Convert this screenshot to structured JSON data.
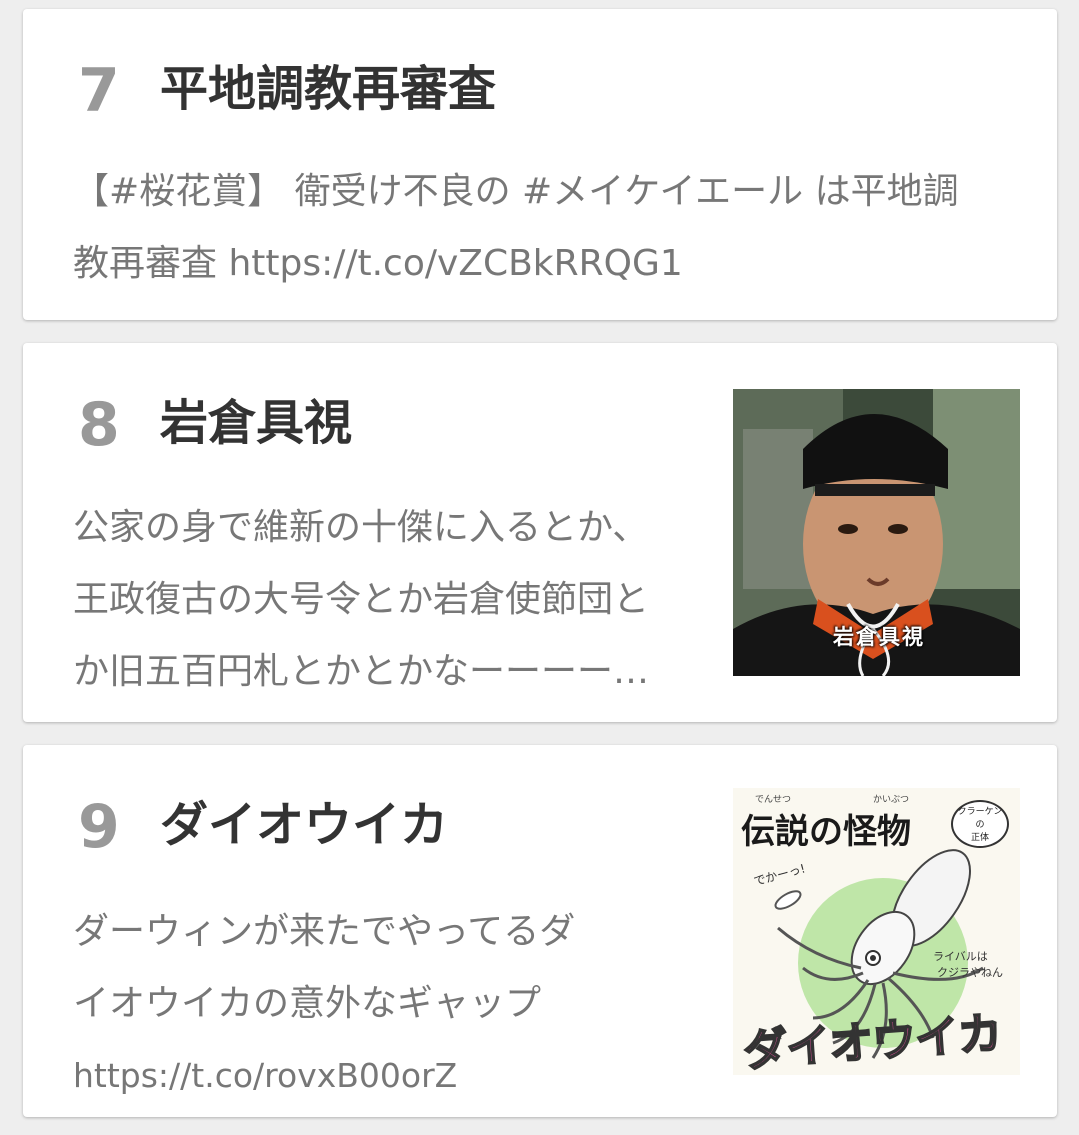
{
  "items": [
    {
      "rank": "7",
      "title": "平地調教再審査",
      "lines": [
        "【#桜花賞】 衛受け不良の #メイケイエール は平地調",
        "教再審査 https://t.co/vZCBkRRQG1"
      ]
    },
    {
      "rank": "8",
      "title": "岩倉具視",
      "lines": [
        "公家の身で維新の十傑に入るとか、",
        "王政復古の大号令とか岩倉使節団と",
        "か旧五百円札とかとかなーーーー…"
      ],
      "thumbnail": {
        "caption": "岩倉具視"
      }
    },
    {
      "rank": "9",
      "title": "ダイオウイカ",
      "lines": [
        "ダーウィンが来たでやってるダ",
        "イオウイカの意外なギャップ",
        "https://t.co/rovxB00orZ"
      ],
      "thumbnail": {
        "heading": "伝説の怪物",
        "ruby_densetsu": "でんせつ",
        "ruby_kaibutsu": "かいぶつ",
        "bubble_line1": "クラーケン",
        "bubble_line2": "の",
        "bubble_line3": "正体",
        "shout": "でかーっ!",
        "rival_line1": "ライバルは",
        "rival_line2": "クジラやねん",
        "name": "ダイオウイカ"
      }
    }
  ],
  "colors": {
    "background": "#eeeeee",
    "card": "#ffffff",
    "rank": "#999999",
    "title": "#333333",
    "text": "#777777",
    "illustration_green": "#bfe6a8",
    "illustration_pink": "#e0529a"
  }
}
